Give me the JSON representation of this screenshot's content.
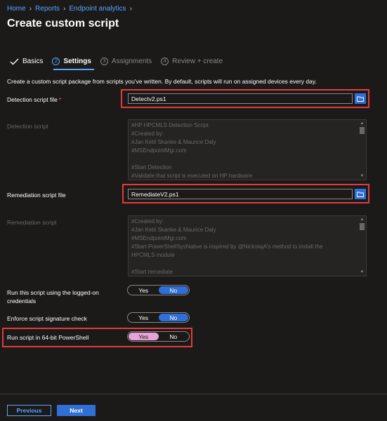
{
  "breadcrumb": [
    {
      "label": "Home"
    },
    {
      "label": "Reports"
    },
    {
      "label": "Endpoint analytics"
    }
  ],
  "page_title": "Create custom script",
  "steps": [
    {
      "number": "",
      "label": "Basics",
      "state": "completed"
    },
    {
      "number": "2",
      "label": "Settings",
      "state": "active"
    },
    {
      "number": "3",
      "label": "Assignments",
      "state": "pending"
    },
    {
      "number": "4",
      "label": "Review + create",
      "state": "pending"
    }
  ],
  "description": "Create a custom script package from scripts you've written. By default, scripts will run on assigned devices every day.",
  "detection_file": {
    "label": "Detection script file",
    "required_mark": "*",
    "value": "Detectv2.ps1"
  },
  "detection_script": {
    "label": "Detection script",
    "lines": [
      "#HP HPCMLS Detection Script",
      "#Created by:",
      "#Jan Ketil Skanke & Maurice Daly",
      "#MSEndpointMgr.com",
      "",
      "#Start Detection",
      "#Validate that script is executed on HP hardware"
    ]
  },
  "remediation_file": {
    "label": "Remediation script file",
    "value": "RemediateV2.ps1"
  },
  "remediation_script": {
    "label": "Remediation script",
    "lines": [
      "#Created by:",
      "#Jan Ketil Skanke & Maurice Daly",
      "#MSEndpointMgr.com",
      "#Start-PowerShellSysNative is inspired by @NickolajA's method to install the",
      "HPCMLS module",
      "",
      "#Start remediate"
    ]
  },
  "logged_on": {
    "label_line1": "Run this script using the logged-on",
    "label_line2": "credentials",
    "yes": "Yes",
    "no": "No",
    "selected": "No"
  },
  "signature_check": {
    "label": "Enforce script signature check",
    "yes": "Yes",
    "no": "No",
    "selected": "No"
  },
  "run_64bit": {
    "label": "Run script in 64-bit PowerShell",
    "yes": "Yes",
    "no": "No",
    "selected": "Yes"
  },
  "footer": {
    "previous": "Previous",
    "next": "Next"
  },
  "colors": {
    "accent": "#2f6fd6",
    "link": "#58a6ff",
    "highlight_box": "#e23b3b",
    "selected_pink": "#e6a3d7"
  }
}
